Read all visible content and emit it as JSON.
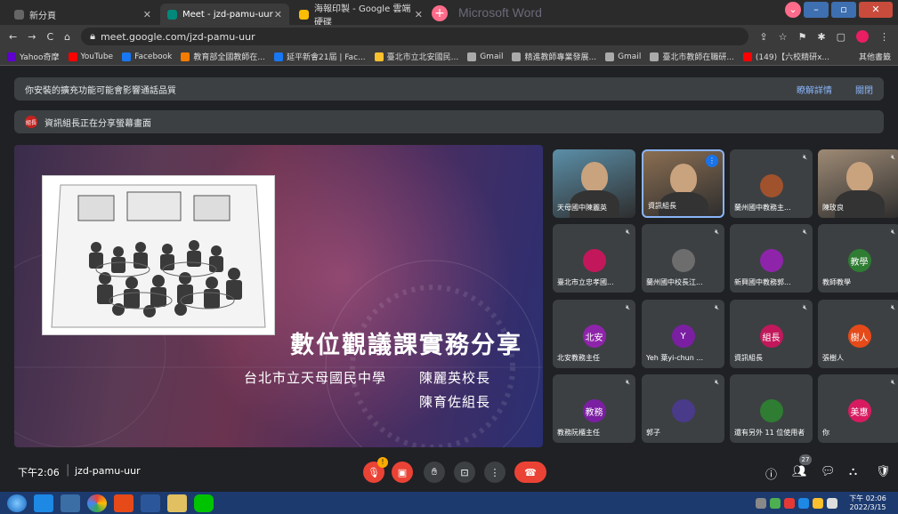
{
  "browser": {
    "tabs": [
      {
        "label": "新分頁",
        "color": "#666"
      },
      {
        "label": "Meet - jzd-pamu-uur",
        "color": "#00897b"
      },
      {
        "label": "海報印製 - Google 雲端硬碟",
        "color": "#fbbc04"
      }
    ],
    "ghost_title": "Microsoft Word",
    "url": "meet.google.com/jzd-pamu-uur",
    "bookmarks": [
      {
        "label": "Yahoo奇摩",
        "color": "#6001d2"
      },
      {
        "label": "YouTube",
        "color": "#ff0000"
      },
      {
        "label": "Facebook",
        "color": "#1877f2"
      },
      {
        "label": "教育部全國教師在...",
        "color": "#f57c00"
      },
      {
        "label": "延平新會21屆 | Fac...",
        "color": "#1877f2"
      },
      {
        "label": "臺北市立北安國民...",
        "color": "#fbc02d"
      },
      {
        "label": "Gmail",
        "color": "#aaa"
      },
      {
        "label": "精進教師專業發展...",
        "color": "#aaa"
      },
      {
        "label": "Gmail",
        "color": "#aaa"
      },
      {
        "label": "臺北市教師在職研...",
        "color": "#aaa"
      },
      {
        "label": "(149)【六校精研x...",
        "color": "#ff0000"
      }
    ],
    "other_bookmarks": "其他書籤"
  },
  "banners": {
    "extension_warning": "你安裝的擴充功能可能會影響通話品質",
    "learn_more": "瞭解詳情",
    "close": "關閉",
    "presenter_badge": "組長",
    "presenting": "資訊組長正在分享螢幕畫面"
  },
  "slide": {
    "title": "數位觀議課實務分享",
    "school": "台北市立天母國民中學",
    "speaker1": "陳麗英校長",
    "speaker2": "陳育佐組長"
  },
  "participants": [
    {
      "name": "天母國中陳麗英",
      "avatar": "",
      "color": "#5b8fa8",
      "muted": false,
      "photo": true
    },
    {
      "name": "資訊組長",
      "avatar": "",
      "color": "#8a6e52",
      "muted": false,
      "photo": true
    },
    {
      "name": "蘭州國中教務主...",
      "avatar": "",
      "color": "#a0522d",
      "muted": true,
      "photo": false
    },
    {
      "name": "陳玫良",
      "avatar": "",
      "color": "#9e8a75",
      "muted": true,
      "photo": true
    },
    {
      "name": "臺北市立忠孝國...",
      "avatar": "",
      "color": "#c2185b",
      "muted": true,
      "photo": false
    },
    {
      "name": "蘭州國中校長江...",
      "avatar": "",
      "color": "#6d6d6d",
      "muted": true,
      "photo": false
    },
    {
      "name": "新興國中教務郭...",
      "avatar": "",
      "color": "#8e24aa",
      "muted": true,
      "photo": false
    },
    {
      "name": "教師教學",
      "avatar": "教學",
      "color": "#2e7d32",
      "muted": true,
      "photo": false
    },
    {
      "name": "北安教務主任",
      "avatar": "北安",
      "color": "#8e24aa",
      "muted": true,
      "photo": false
    },
    {
      "name": "Yeh 葉yi-chun ...",
      "avatar": "Y",
      "color": "#7b1fa2",
      "muted": true,
      "photo": false
    },
    {
      "name": "資訊組長",
      "avatar": "組長",
      "color": "#c2185b",
      "muted": true,
      "photo": false
    },
    {
      "name": "張樹人",
      "avatar": "樹人",
      "color": "#e64a19",
      "muted": true,
      "photo": false
    },
    {
      "name": "教務阮櫃主任",
      "avatar": "教務",
      "color": "#7b1fa2",
      "muted": true,
      "photo": false
    },
    {
      "name": "郭子",
      "avatar": "",
      "color": "#4a3a8a",
      "muted": true,
      "photo": false
    },
    {
      "name": "還有另外 11 位使用者",
      "avatar": "",
      "color": "#2e7d32",
      "muted": false,
      "photo": false
    },
    {
      "name": "你",
      "avatar": "美惠",
      "color": "#d81b60",
      "muted": true,
      "photo": false
    }
  ],
  "meeting": {
    "time": "下午2:06",
    "code": "jzd-pamu-uur",
    "people_count": "27",
    "mic_badge": "!"
  },
  "taskbar": {
    "clock_time": "下午 02:06",
    "clock_date": "2022/3/15"
  }
}
